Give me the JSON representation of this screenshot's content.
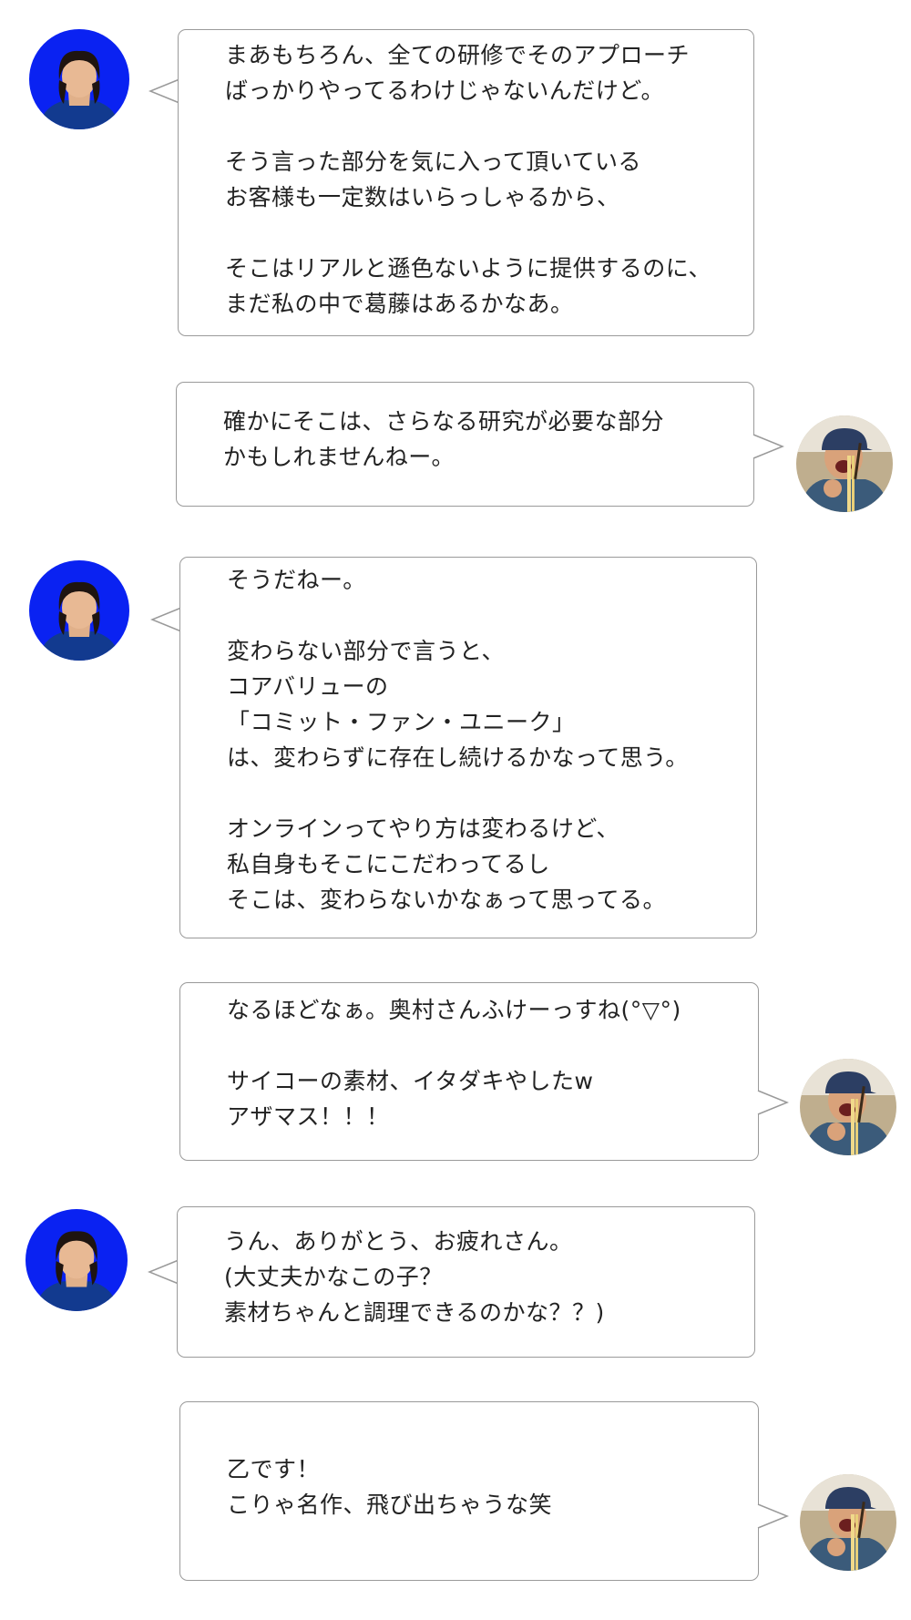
{
  "speakers": {
    "woman": {
      "avatar_icon": "woman-avatar-icon",
      "bg": "#0a22f2",
      "side": "left"
    },
    "man": {
      "avatar_icon": "man-eating-noodles-avatar-icon",
      "side": "right"
    }
  },
  "messages": [
    {
      "speaker": "woman",
      "lines": [
        "まあもちろん、全ての研修でそのアプローチ",
        "ばっかりやってるわけじゃないんだけど。",
        "",
        "そう言った部分を気に入って頂いている",
        "お客様も一定数はいらっしゃるから、",
        "",
        "そこはリアルと遜色ないように提供するのに、",
        "まだ私の中で葛藤はあるかなあ。"
      ]
    },
    {
      "speaker": "man",
      "lines": [
        "確かにそこは、さらなる研究が必要な部分",
        "かもしれませんねー。"
      ]
    },
    {
      "speaker": "woman",
      "lines": [
        "そうだねー。",
        "",
        "変わらない部分で言うと、",
        "コアバリューの",
        "「コミット・ファン・ユニーク」",
        "は、変わらずに存在し続けるかなって思う。",
        "",
        "オンラインってやり方は変わるけど、",
        "私自身もそこにこだわってるし",
        "そこは、変わらないかなぁって思ってる。"
      ]
    },
    {
      "speaker": "man",
      "lines": [
        "なるほどなぁ。奥村さんふけーっすね(°▽°)",
        "",
        "サイコーの素材、イタダキやしたw",
        "アザマス！！！"
      ]
    },
    {
      "speaker": "woman",
      "lines": [
        "うん、ありがとう、お疲れさん。",
        "(大丈夫かなこの子？",
        "素材ちゃんと調理できるのかな？？)"
      ]
    },
    {
      "speaker": "man",
      "lines": [
        "乙です！",
        "こりゃ名作、飛び出ちゃうな笑"
      ]
    }
  ]
}
